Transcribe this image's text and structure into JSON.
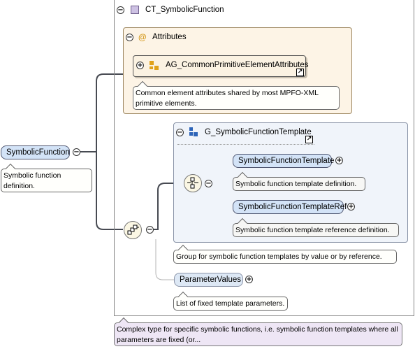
{
  "ct": {
    "title": "CT_SymbolicFunction"
  },
  "attributes": {
    "title": "Attributes",
    "at_symbol": "@"
  },
  "attr_group": {
    "label": "AG_CommonPrimitiveElementAttributes"
  },
  "attr_group_note": {
    "text": "Common element attributes shared by most MPFO-XML primitive elements."
  },
  "root": {
    "label": "SymbolicFunction",
    "note": "Symbolic function definition."
  },
  "group": {
    "title": "G_SymbolicFunctionTemplate",
    "note": "Group for symbolic function templates by value or by reference."
  },
  "choice_children": [
    {
      "label": "SymbolicFunctionTemplate",
      "note": "Symbolic function template definition."
    },
    {
      "label": "SymbolicFunctionTemplateRef",
      "note": "Symbolic function template reference definition."
    }
  ],
  "parameter_values": {
    "label": "ParameterValues",
    "note": "List of fixed template parameters."
  },
  "ct_note": {
    "text": "Complex type for specific symbolic functions, i.e. symbolic function templates where all parameters are fixed (or..."
  },
  "icons": {
    "collapse": "−",
    "expand": "+",
    "external_link": "↗"
  },
  "colors": {
    "element_fill": "#d3e3f7",
    "complex_type_note": "#eee6f5",
    "attributes_fill": "#fdf4e6",
    "group_fill": "#f0f4fa"
  }
}
